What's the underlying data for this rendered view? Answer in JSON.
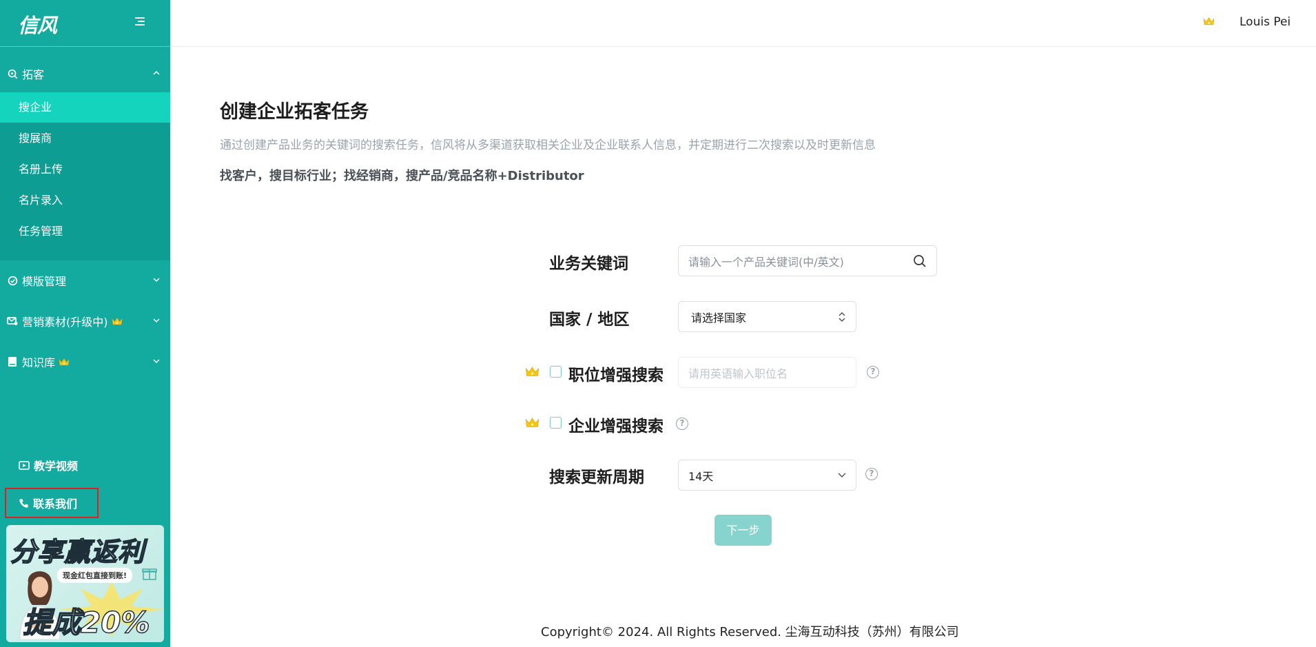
{
  "app": {
    "brand": "信风"
  },
  "sidebar": {
    "sections": [
      {
        "label": "拓客",
        "icon": "search-target-icon",
        "expanded": true
      },
      {
        "label": "模版管理",
        "icon": "check-circle-icon",
        "expanded": false
      },
      {
        "label": "营销素材(升级中)",
        "icon": "mail-icon",
        "premium": true,
        "expanded": false
      },
      {
        "label": "知识库",
        "icon": "book-icon",
        "premium": true,
        "expanded": false
      }
    ],
    "submenu": [
      {
        "label": "搜企业",
        "active": true
      },
      {
        "label": "搜展商"
      },
      {
        "label": "名册上传"
      },
      {
        "label": "名片录入"
      },
      {
        "label": "任务管理"
      }
    ],
    "bottom": {
      "tutorial": "教学视频",
      "contact": "联系我们"
    },
    "promo": {
      "title": "分享赢返利",
      "subtitle": "现金红包直接到账!",
      "rate": "提成20%"
    }
  },
  "header": {
    "username": "Louis Pei"
  },
  "main": {
    "title": "创建企业拓客任务",
    "description": "通过创建产品业务的关键词的搜索任务，信风将从多渠道获取相关企业及企业联系人信息，并定期进行二次搜索以及时更新信息",
    "tip": "找客户，搜目标行业；找经销商，搜产品/竞品名称+Distributor",
    "form": {
      "keyword_label": "业务关键词",
      "keyword_placeholder": "请输入一个产品关键词(中/英文)",
      "country_label": "国家 / 地区",
      "country_value": "请选择国家",
      "position_label": "职位增强搜索",
      "position_placeholder": "请用英语输入职位名",
      "company_label": "企业增强搜索",
      "cycle_label": "搜索更新周期",
      "cycle_value": "14天",
      "help_mark": "?"
    },
    "next_button": "下一步"
  },
  "footer": {
    "copyright": "Copyright© 2024. All Rights Reserved. 尘海互动科技（苏州）有限公司"
  },
  "colors": {
    "sidebar": "#13aaa0",
    "submenu": "#0e9d92",
    "active_item": "#15d4bd",
    "crown": "#f5c518",
    "button_disabled": "#86d4cd",
    "highlight_box": "#e02020"
  }
}
